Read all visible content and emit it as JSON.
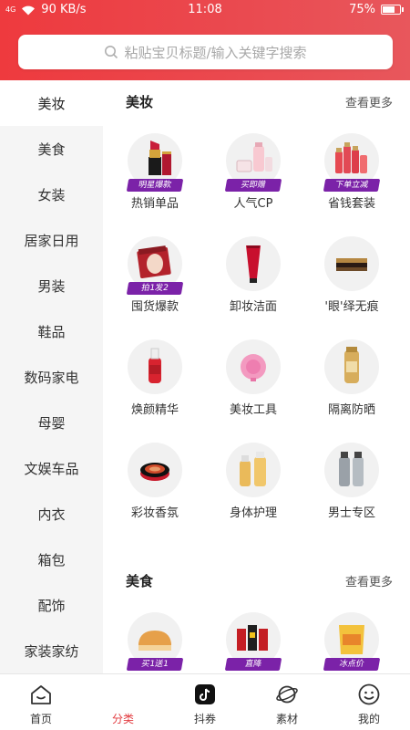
{
  "status_bar": {
    "signal": "4G",
    "speed": "90 KB/s",
    "time": "11:08",
    "battery": "75%",
    "battery_level": 0.75
  },
  "search": {
    "placeholder": "粘贴宝贝标题/输入关键字搜索"
  },
  "sidebar": {
    "items": [
      "美妆",
      "美食",
      "女装",
      "居家日用",
      "男装",
      "鞋品",
      "数码家电",
      "母婴",
      "文娱车品",
      "内衣",
      "箱包",
      "配饰",
      "家装家纺"
    ],
    "active_index": 0
  },
  "sections": [
    {
      "title": "美妆",
      "more": "查看更多",
      "items": [
        {
          "label": "热销单品",
          "badge": "明星爆款",
          "icon": "lipstick-icon"
        },
        {
          "label": "人气CP",
          "badge": "买即赠",
          "icon": "skincare-set-icon"
        },
        {
          "label": "省钱套装",
          "badge": "下单立减",
          "icon": "bottle-set-icon"
        },
        {
          "label": "囤货爆款",
          "badge": "拍1发2",
          "icon": "face-mask-icon"
        },
        {
          "label": "卸妆洁面",
          "badge": "",
          "icon": "cleanser-tube-icon"
        },
        {
          "label": "'眼'绎无痕",
          "badge": "",
          "icon": "eye-cream-icon"
        },
        {
          "label": "焕颜精华",
          "badge": "",
          "icon": "serum-bottle-icon"
        },
        {
          "label": "美妆工具",
          "badge": "",
          "icon": "cleansing-brush-icon"
        },
        {
          "label": "隔离防晒",
          "badge": "",
          "icon": "sunscreen-icon"
        },
        {
          "label": "彩妆香氛",
          "badge": "",
          "icon": "cushion-compact-icon"
        },
        {
          "label": "身体护理",
          "badge": "",
          "icon": "body-care-bottles-icon"
        },
        {
          "label": "男士专区",
          "badge": "",
          "icon": "mens-care-bottles-icon"
        }
      ]
    },
    {
      "title": "美食",
      "more": "查看更多",
      "items": [
        {
          "label": "欢乐早餐",
          "badge": "买1送1",
          "icon": "bread-icon"
        },
        {
          "label": "美味速食",
          "badge": "直降",
          "icon": "snack-packs-icon"
        },
        {
          "label": "休闲零食",
          "badge": "冰点价",
          "icon": "chips-bag-icon"
        }
      ]
    }
  ],
  "tabbar": {
    "items": [
      {
        "label": "首页",
        "icon": "home-icon"
      },
      {
        "label": "分类",
        "icon": ""
      },
      {
        "label": "抖券",
        "icon": "douyin-icon"
      },
      {
        "label": "素材",
        "icon": "planet-icon"
      },
      {
        "label": "我的",
        "icon": "smiley-icon"
      }
    ],
    "active_index": 1
  },
  "colors": {
    "brand": "#ee3a3e",
    "badge": "#7b22a8",
    "active_tab": "#e23b3f"
  }
}
